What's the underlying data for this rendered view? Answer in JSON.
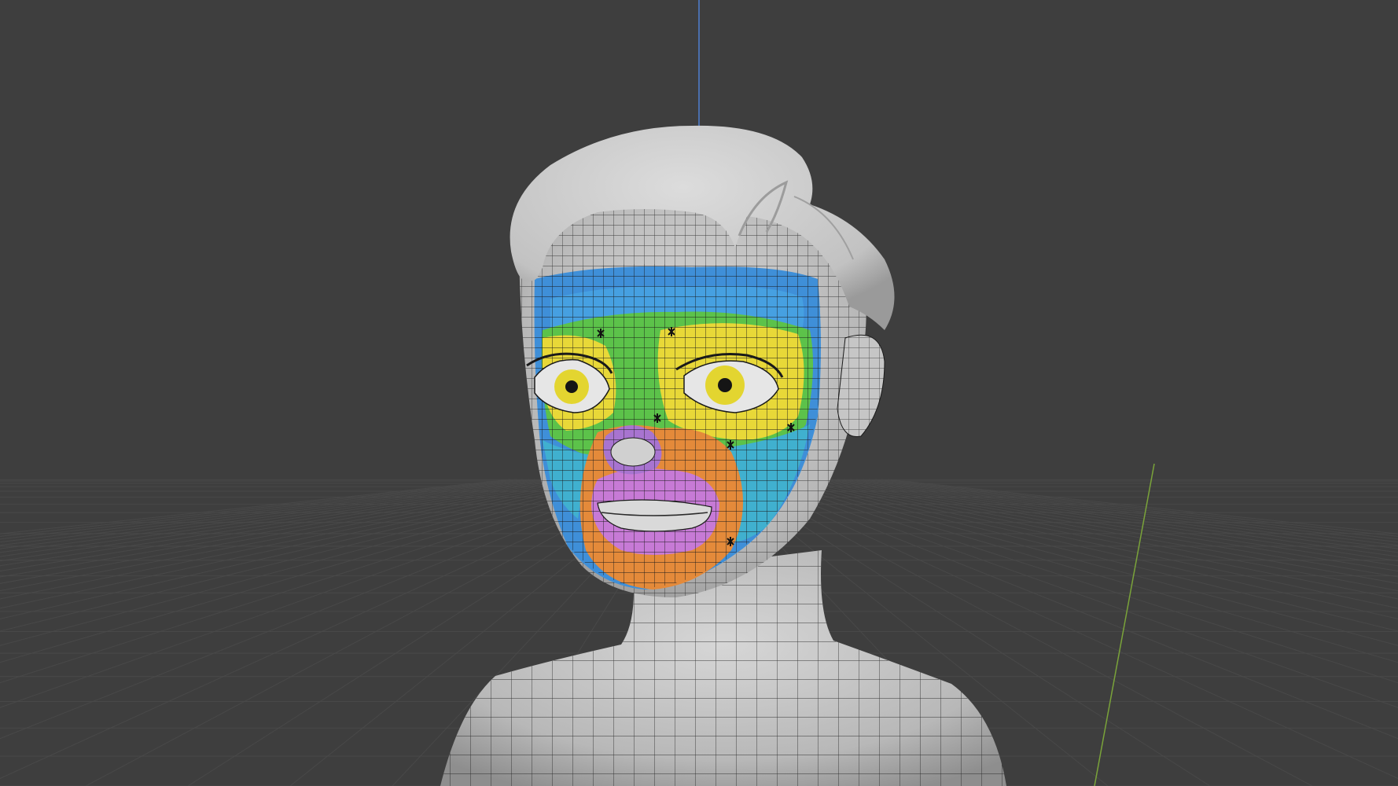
{
  "viewport": {
    "background": "#3e3e3e",
    "grid_color": "#4a4a4a",
    "axis_z_color": "#4f7fd1",
    "axis_y_color": "#7aa33a"
  },
  "model": {
    "skin_color": "#bdbdbd",
    "hair_color": "#c9c9c9",
    "wire_color": "#1a1a1a",
    "regions": {
      "outer_band": "#3f8fd8",
      "forehead_ring": "#4aa7e6",
      "green_ring": "#5cc24a",
      "yellow_ring": "#e8d838",
      "cheek": "#40b0cf",
      "orange_ring": "#e48a3a",
      "mouth_purple": "#c77ad6",
      "nose_purple": "#a874d0",
      "iris": "#e3d530",
      "pupil": "#151515"
    }
  }
}
